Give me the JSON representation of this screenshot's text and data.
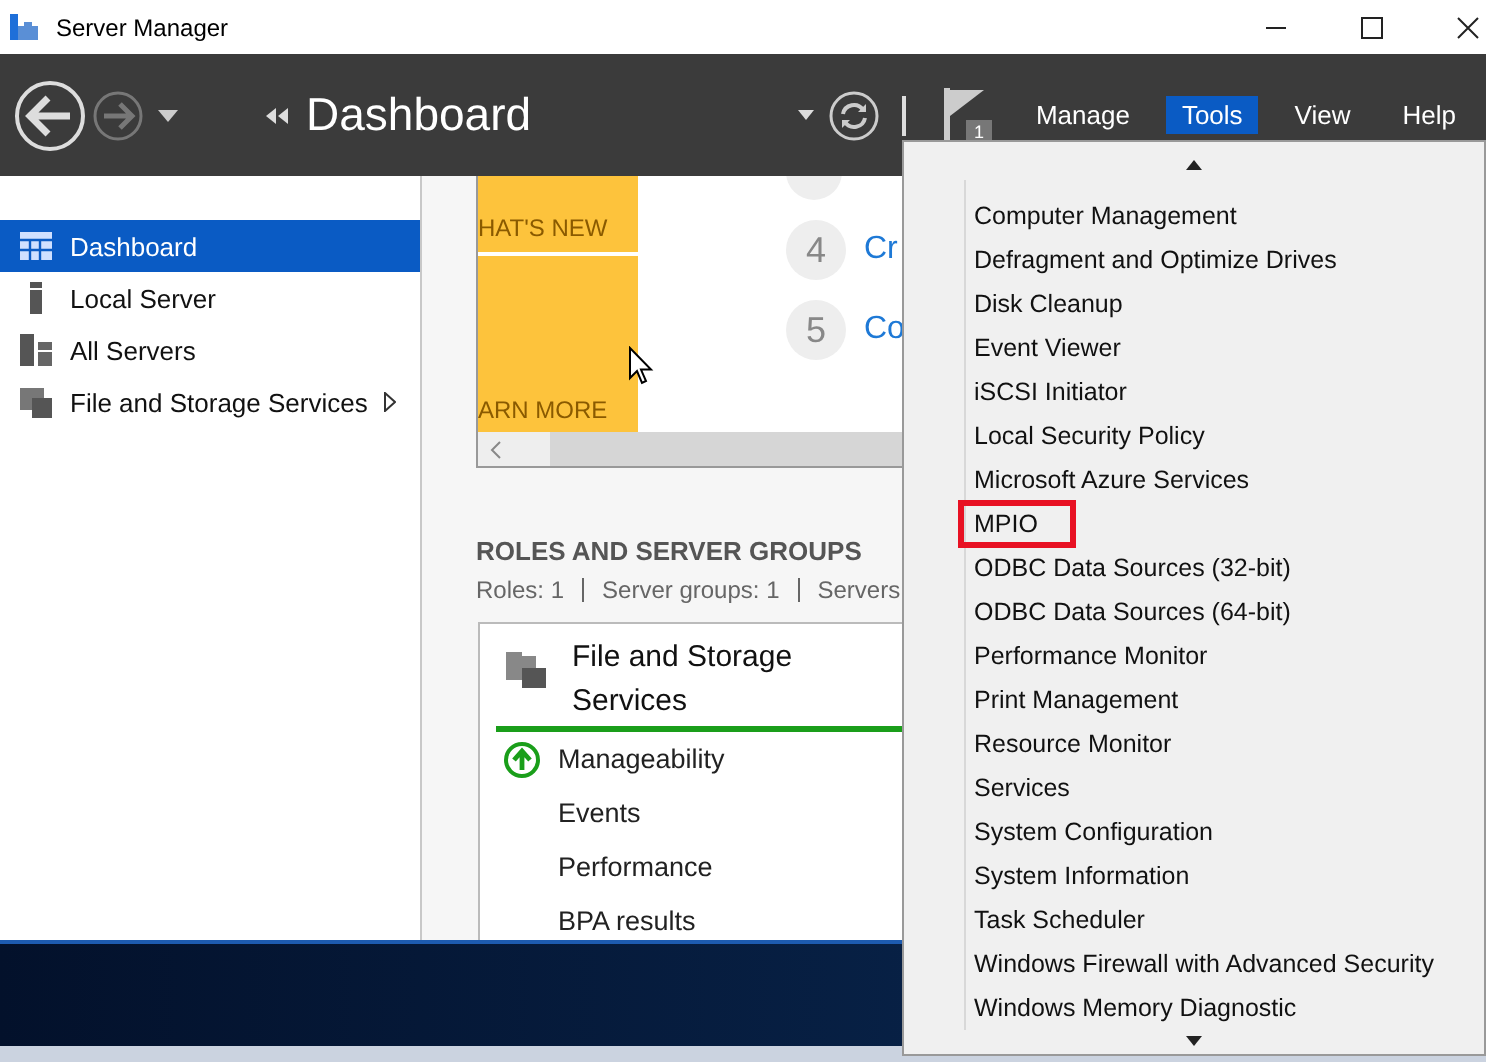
{
  "window": {
    "title": "Server Manager"
  },
  "toolbar": {
    "breadcrumb": "Dashboard",
    "notification_count": "1",
    "menus": [
      {
        "label": "Manage",
        "selected": false
      },
      {
        "label": "Tools",
        "selected": true
      },
      {
        "label": "View",
        "selected": false
      },
      {
        "label": "Help",
        "selected": false
      }
    ]
  },
  "sidebar": {
    "items": [
      {
        "label": "Dashboard",
        "kind": "dashboard",
        "selected": true,
        "has_submenu": false
      },
      {
        "label": "Local Server",
        "kind": "server",
        "selected": false,
        "has_submenu": false
      },
      {
        "label": "All Servers",
        "kind": "servers",
        "selected": false,
        "has_submenu": false
      },
      {
        "label": "File and Storage Services",
        "kind": "storage",
        "selected": false,
        "has_submenu": true
      }
    ]
  },
  "welcome": {
    "tile_texts": [
      "HAT'S NEW",
      "ARN MORE"
    ],
    "steps": [
      {
        "number": "4",
        "text": "Cr"
      },
      {
        "number": "5",
        "text": "Co"
      }
    ]
  },
  "roles": {
    "heading": "ROLES AND SERVER GROUPS",
    "summary": [
      "Roles: 1",
      "Server groups: 1",
      "Servers"
    ],
    "card": {
      "title": "File and Storage Services",
      "rows": [
        {
          "label": "Manageability",
          "kind": "status"
        },
        {
          "label": "Events",
          "kind": "plain"
        },
        {
          "label": "Performance",
          "kind": "plain"
        },
        {
          "label": "BPA results",
          "kind": "plain"
        }
      ]
    }
  },
  "tools_menu": {
    "items": [
      {
        "label": "Computer Management",
        "highlighted": false
      },
      {
        "label": "Defragment and Optimize Drives",
        "highlighted": false
      },
      {
        "label": "Disk Cleanup",
        "highlighted": false
      },
      {
        "label": "Event Viewer",
        "highlighted": false
      },
      {
        "label": "iSCSI Initiator",
        "highlighted": false
      },
      {
        "label": "Local Security Policy",
        "highlighted": false
      },
      {
        "label": "Microsoft Azure Services",
        "highlighted": false
      },
      {
        "label": "MPIO",
        "highlighted": true
      },
      {
        "label": "ODBC Data Sources (32-bit)",
        "highlighted": false
      },
      {
        "label": "ODBC Data Sources (64-bit)",
        "highlighted": false
      },
      {
        "label": "Performance Monitor",
        "highlighted": false
      },
      {
        "label": "Print Management",
        "highlighted": false
      },
      {
        "label": "Resource Monitor",
        "highlighted": false
      },
      {
        "label": "Services",
        "highlighted": false
      },
      {
        "label": "System Configuration",
        "highlighted": false
      },
      {
        "label": "System Information",
        "highlighted": false
      },
      {
        "label": "Task Scheduler",
        "highlighted": false
      },
      {
        "label": "Windows Firewall with Advanced Security",
        "highlighted": false
      },
      {
        "label": "Windows Memory Diagnostic",
        "highlighted": false
      }
    ]
  }
}
